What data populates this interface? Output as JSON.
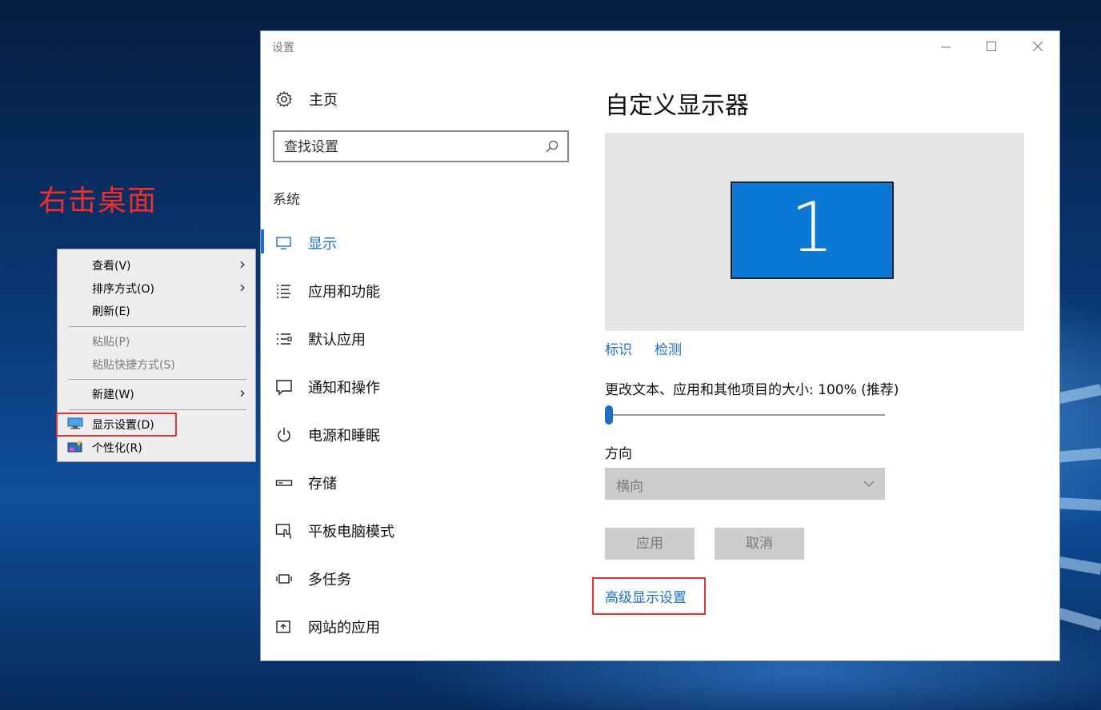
{
  "annotation": {
    "text": "右击桌面"
  },
  "context_menu": {
    "items": [
      {
        "label": "查看(V)",
        "has_submenu": true,
        "disabled": false
      },
      {
        "label": "排序方式(O)",
        "has_submenu": true,
        "disabled": false
      },
      {
        "label": "刷新(E)",
        "has_submenu": false,
        "disabled": false
      },
      {
        "label": "粘贴(P)",
        "has_submenu": false,
        "disabled": true
      },
      {
        "label": "粘贴快捷方式(S)",
        "has_submenu": false,
        "disabled": true
      },
      {
        "label": "新建(W)",
        "has_submenu": true,
        "disabled": false
      },
      {
        "label": "显示设置(D)",
        "icon": "monitor-icon",
        "highlighted": true
      },
      {
        "label": "个性化(R)",
        "icon": "personalize-icon"
      }
    ]
  },
  "window": {
    "title": "设置",
    "controls": [
      "minimize",
      "maximize",
      "close"
    ]
  },
  "sidebar": {
    "home_label": "主页",
    "search_placeholder": "查找设置",
    "section_label": "系统",
    "items": [
      {
        "label": "显示",
        "icon": "display-icon",
        "active": true
      },
      {
        "label": "应用和功能",
        "icon": "apps-list-icon"
      },
      {
        "label": "默认应用",
        "icon": "default-apps-icon"
      },
      {
        "label": "通知和操作",
        "icon": "notification-icon"
      },
      {
        "label": "电源和睡眠",
        "icon": "power-icon"
      },
      {
        "label": "存储",
        "icon": "storage-icon"
      },
      {
        "label": "平板电脑模式",
        "icon": "tablet-mode-icon"
      },
      {
        "label": "多任务",
        "icon": "multitasking-icon"
      },
      {
        "label": "网站的应用",
        "icon": "web-apps-icon"
      }
    ]
  },
  "main": {
    "title": "自定义显示器",
    "monitor_number": "1",
    "identify_link": "标识",
    "detect_link": "检测",
    "scale_label": "更改文本、应用和其他项目的大小: 100% (推荐)",
    "orientation_label": "方向",
    "orientation_value": "横向",
    "apply_button": "应用",
    "cancel_button": "取消",
    "advanced_link": "高级显示设置"
  },
  "colors": {
    "accent": "#1a6fc9",
    "annotation_red": "#e03434",
    "monitor_blue": "#0a79d5"
  }
}
